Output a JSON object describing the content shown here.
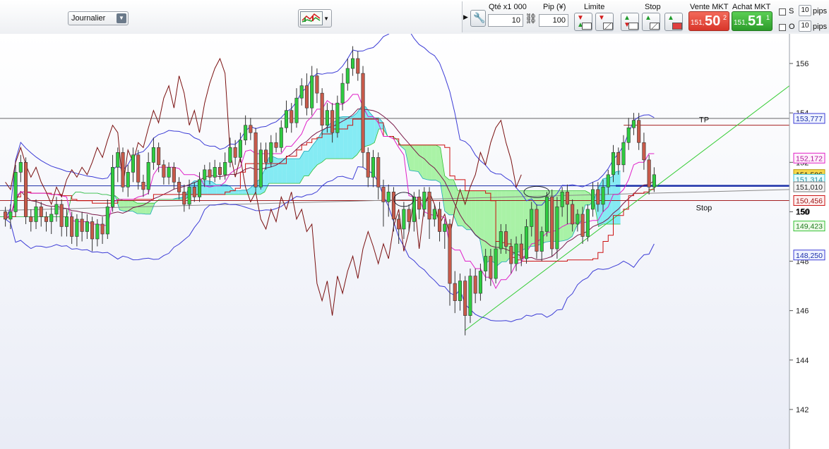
{
  "toolbar": {
    "period": "Journalier"
  },
  "order_panel": {
    "qty_label": "Qté x1 000",
    "qty_value": "10",
    "pip_label": "Pip (¥)",
    "pip_value": "100",
    "limit_label": "Limite",
    "stop_label": "Stop",
    "sell_label": "Vente MKT",
    "sell_small": "151,",
    "sell_big": "50",
    "sell_sup": "2",
    "buy_label": "Achat MKT",
    "buy_small": "151,",
    "buy_big": "51",
    "buy_sup": "1",
    "s_label": "S",
    "o_label": "O",
    "s_pips": "10",
    "o_pips": "10",
    "pips_unit": "pips"
  },
  "colors": {
    "cloud_bull": "#5ee6f0",
    "cloud_bear": "#8ff08a",
    "bull_candle": "#2ecc40",
    "bear_candle": "#c85a4a",
    "bollinger": "#3c3cd6",
    "kijun": "#cc1111",
    "tenkan": "#e020c8",
    "chikou": "#7a1010",
    "mid": "#7a1a4a"
  },
  "chart_data": {
    "type": "candlestick",
    "y_axis_ticks": [
      142,
      144,
      146,
      148,
      150,
      152,
      154,
      156
    ],
    "ylim": [
      140.4,
      157.2
    ],
    "y_axis_bold": "150",
    "price_tags": [
      {
        "value": 153.777,
        "text": "153,777",
        "style": "blue-outline"
      },
      {
        "value": 152.172,
        "text": "152,172",
        "style": "pink-outline"
      },
      {
        "value": 151.506,
        "text": "151,506",
        "style": "yellow"
      },
      {
        "value": 151.314,
        "text": "151,314",
        "style": "cyan-outline"
      },
      {
        "value": 151.01,
        "text": "151,010",
        "style": "gray-outline"
      },
      {
        "value": 150.456,
        "text": "150,456",
        "style": "red-outline"
      },
      {
        "value": 149.423,
        "text": "149,423",
        "style": "green-outline"
      },
      {
        "value": 148.25,
        "text": "148,250",
        "style": "blue-outline"
      }
    ],
    "horizontal_lines": [
      {
        "value": 153.777,
        "label": "",
        "color": "#666666"
      },
      {
        "value": 153.5,
        "label": "TP",
        "color": "#990000",
        "x_start": 0.79
      },
      {
        "value": 150.456,
        "label": "Stop",
        "color": "#990000",
        "x_start": 0.0
      },
      {
        "value": 151.05,
        "label": "",
        "color": "#1a2ea8",
        "heavy_from": 0.78
      }
    ],
    "annotations": [
      "TP",
      "Stop"
    ],
    "candles": [
      [
        150.0,
        149.7,
        150.2,
        149.4
      ],
      [
        149.7,
        150.0,
        150.3,
        149.3
      ],
      [
        150.0,
        151.6,
        151.9,
        149.8
      ],
      [
        151.6,
        152.0,
        152.3,
        151.2
      ],
      [
        152.0,
        149.8,
        152.2,
        149.5
      ],
      [
        149.8,
        149.6,
        150.1,
        149.2
      ],
      [
        149.6,
        150.2,
        150.5,
        149.3
      ],
      [
        150.2,
        149.8,
        150.4,
        149.4
      ],
      [
        149.8,
        149.6,
        150.0,
        149.2
      ],
      [
        149.6,
        149.9,
        150.2,
        149.1
      ],
      [
        149.9,
        150.3,
        150.6,
        149.6
      ],
      [
        150.3,
        149.4,
        150.5,
        149.0
      ],
      [
        149.4,
        149.8,
        150.1,
        149.0
      ],
      [
        149.8,
        149.0,
        150.0,
        148.7
      ],
      [
        149.0,
        149.7,
        149.9,
        148.6
      ],
      [
        149.7,
        149.2,
        150.0,
        148.8
      ],
      [
        149.2,
        149.6,
        149.9,
        148.9
      ],
      [
        149.6,
        148.9,
        149.8,
        148.4
      ],
      [
        148.9,
        149.5,
        149.7,
        148.6
      ],
      [
        149.5,
        149.1,
        149.8,
        148.7
      ],
      [
        149.1,
        150.2,
        150.5,
        148.9
      ],
      [
        150.2,
        151.8,
        152.3,
        150.0
      ],
      [
        151.8,
        152.4,
        152.6,
        151.2
      ],
      [
        152.4,
        151.0,
        152.6,
        150.8
      ],
      [
        151.0,
        151.6,
        151.9,
        150.6
      ],
      [
        151.6,
        152.3,
        152.6,
        151.2
      ],
      [
        152.3,
        151.2,
        152.5,
        150.9
      ],
      [
        151.2,
        150.9,
        151.5,
        150.6
      ],
      [
        150.9,
        152.0,
        152.4,
        150.7
      ],
      [
        152.0,
        152.6,
        153.0,
        151.7
      ],
      [
        152.6,
        151.9,
        152.8,
        151.6
      ],
      [
        151.9,
        151.4,
        152.1,
        151.1
      ],
      [
        151.4,
        151.8,
        152.0,
        151.1
      ],
      [
        151.8,
        151.2,
        152.0,
        150.9
      ],
      [
        151.2,
        150.8,
        151.4,
        150.5
      ],
      [
        150.8,
        150.3,
        151.1,
        150.0
      ],
      [
        150.3,
        151.0,
        151.3,
        150.1
      ],
      [
        151.0,
        150.6,
        151.2,
        150.4
      ],
      [
        150.6,
        151.3,
        151.6,
        150.4
      ],
      [
        151.3,
        151.7,
        151.9,
        151.0
      ],
      [
        151.7,
        151.4,
        152.0,
        151.1
      ],
      [
        151.4,
        151.8,
        152.1,
        151.2
      ],
      [
        151.8,
        151.5,
        152.0,
        151.3
      ],
      [
        151.5,
        152.0,
        152.4,
        151.3
      ],
      [
        152.0,
        152.6,
        153.0,
        151.8
      ],
      [
        152.6,
        152.2,
        152.9,
        151.9
      ],
      [
        152.2,
        152.9,
        153.2,
        152.0
      ],
      [
        152.9,
        153.5,
        153.9,
        152.7
      ],
      [
        153.5,
        153.2,
        153.8,
        152.9
      ],
      [
        153.2,
        151.0,
        153.4,
        150.8
      ],
      [
        151.0,
        152.5,
        152.8,
        150.9
      ],
      [
        152.5,
        152.0,
        152.8,
        151.7
      ],
      [
        152.0,
        152.8,
        153.1,
        151.8
      ],
      [
        152.8,
        152.6,
        153.2,
        152.4
      ],
      [
        152.6,
        153.4,
        153.7,
        152.4
      ],
      [
        153.4,
        154.1,
        154.5,
        153.2
      ],
      [
        154.1,
        153.6,
        154.4,
        153.2
      ],
      [
        153.6,
        154.6,
        155.0,
        153.4
      ],
      [
        154.6,
        155.1,
        155.4,
        154.3
      ],
      [
        155.1,
        154.2,
        155.6,
        153.9
      ],
      [
        154.2,
        155.5,
        155.9,
        153.9
      ],
      [
        155.5,
        154.8,
        155.8,
        154.4
      ],
      [
        154.8,
        153.5,
        155.0,
        153.1
      ],
      [
        153.5,
        154.1,
        154.4,
        153.2
      ],
      [
        154.1,
        153.2,
        154.4,
        152.8
      ],
      [
        153.2,
        154.4,
        154.7,
        153.0
      ],
      [
        154.4,
        155.2,
        155.6,
        154.1
      ],
      [
        155.2,
        155.8,
        156.2,
        154.9
      ],
      [
        155.8,
        156.2,
        156.7,
        155.5
      ],
      [
        156.2,
        155.6,
        156.5,
        155.3
      ],
      [
        155.6,
        152.4,
        155.9,
        151.8
      ],
      [
        152.4,
        151.4,
        152.6,
        151.0
      ],
      [
        151.4,
        152.2,
        152.5,
        151.0
      ],
      [
        152.2,
        151.0,
        152.4,
        150.5
      ],
      [
        151.0,
        150.4,
        151.3,
        149.4
      ],
      [
        150.4,
        150.8,
        151.1,
        149.8
      ],
      [
        150.8,
        149.7,
        151.0,
        149.2
      ],
      [
        149.7,
        149.3,
        149.9,
        148.7
      ],
      [
        149.3,
        150.1,
        150.4,
        148.9
      ],
      [
        150.1,
        149.6,
        150.3,
        149.2
      ],
      [
        149.6,
        150.6,
        150.8,
        149.2
      ],
      [
        150.6,
        150.1,
        150.9,
        149.7
      ],
      [
        150.1,
        150.8,
        151.0,
        149.8
      ],
      [
        150.8,
        149.7,
        151.0,
        148.9
      ],
      [
        149.7,
        150.1,
        150.3,
        149.4
      ],
      [
        150.1,
        149.2,
        150.4,
        148.8
      ],
      [
        149.2,
        149.5,
        149.7,
        148.5
      ],
      [
        149.5,
        147.1,
        149.7,
        146.2
      ],
      [
        147.1,
        146.4,
        147.6,
        145.9
      ],
      [
        146.4,
        147.2,
        147.5,
        146.0
      ],
      [
        147.2,
        145.8,
        147.4,
        145.0
      ],
      [
        145.8,
        147.4,
        147.7,
        145.5
      ],
      [
        147.4,
        146.7,
        147.7,
        146.3
      ],
      [
        146.7,
        147.6,
        147.9,
        146.4
      ],
      [
        147.6,
        148.2,
        148.5,
        147.2
      ],
      [
        148.2,
        147.3,
        148.5,
        147.0
      ],
      [
        147.3,
        148.5,
        148.8,
        147.1
      ],
      [
        148.5,
        149.2,
        149.5,
        148.3
      ],
      [
        149.2,
        148.6,
        149.5,
        148.3
      ],
      [
        148.6,
        147.9,
        148.9,
        147.5
      ],
      [
        147.9,
        148.7,
        149.0,
        147.6
      ],
      [
        148.7,
        148.1,
        149.1,
        147.8
      ],
      [
        148.1,
        149.4,
        149.7,
        147.9
      ],
      [
        149.4,
        150.1,
        150.4,
        149.0
      ],
      [
        150.1,
        148.4,
        150.3,
        148.1
      ],
      [
        148.4,
        149.2,
        149.4,
        148.0
      ],
      [
        149.2,
        150.6,
        150.8,
        149.0
      ],
      [
        150.6,
        148.5,
        150.9,
        148.2
      ],
      [
        148.5,
        150.2,
        150.6,
        148.1
      ],
      [
        150.2,
        150.8,
        151.0,
        149.8
      ],
      [
        150.8,
        150.3,
        151.1,
        149.5
      ],
      [
        150.3,
        149.5,
        150.5,
        149.2
      ],
      [
        149.5,
        149.9,
        150.1,
        149.2
      ],
      [
        149.9,
        149.0,
        150.2,
        148.7
      ],
      [
        149.0,
        150.1,
        150.3,
        148.8
      ],
      [
        150.1,
        150.9,
        151.2,
        149.8
      ],
      [
        150.9,
        150.3,
        151.2,
        150.0
      ],
      [
        150.3,
        151.0,
        151.3,
        150.0
      ],
      [
        151.0,
        151.5,
        151.7,
        150.7
      ],
      [
        151.5,
        152.4,
        152.7,
        151.2
      ],
      [
        152.4,
        151.9,
        152.6,
        151.5
      ],
      [
        151.9,
        152.8,
        153.1,
        151.6
      ],
      [
        152.8,
        153.4,
        153.8,
        152.5
      ],
      [
        153.4,
        153.7,
        154.0,
        153.1
      ],
      [
        153.7,
        152.8,
        154.0,
        152.5
      ],
      [
        152.8,
        152.1,
        153.2,
        151.7
      ],
      [
        152.1,
        151.0,
        152.3,
        150.7
      ],
      [
        151.0,
        151.5,
        151.8,
        150.8
      ]
    ]
  }
}
